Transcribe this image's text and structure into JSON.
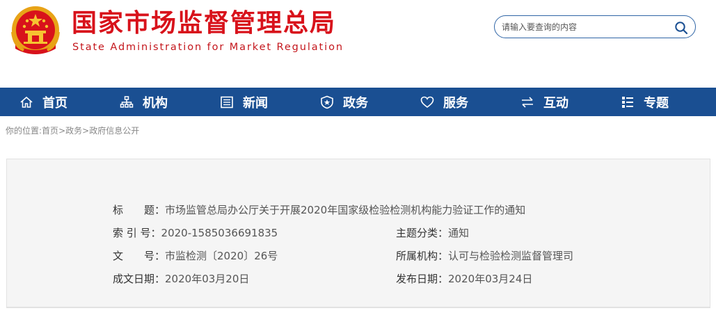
{
  "header": {
    "title_cn": "国家市场监督管理总局",
    "title_en": "State Administration for Market Regulation",
    "emblem_icon": "national-emblem-icon"
  },
  "search": {
    "placeholder": "请输入要查询的内容",
    "icon": "search-icon"
  },
  "nav": {
    "items": [
      {
        "label": "首页",
        "icon": "home-icon"
      },
      {
        "label": "机构",
        "icon": "organization-icon"
      },
      {
        "label": "新闻",
        "icon": "news-icon"
      },
      {
        "label": "政务",
        "icon": "government-icon"
      },
      {
        "label": "服务",
        "icon": "heart-icon"
      },
      {
        "label": "互动",
        "icon": "exchange-icon"
      },
      {
        "label": "专题",
        "icon": "topic-icon"
      }
    ]
  },
  "breadcrumb": {
    "prefix": "你的位置:",
    "items": [
      "首页",
      "政务",
      "政府信息公开"
    ],
    "separator": ">"
  },
  "info": {
    "title_label": "标　　题：",
    "title_value": "市场监管总局办公厅关于开展2020年国家级检验检测机构能力验证工作的通知",
    "index_label": "索 引 号：",
    "index_value": "2020-1585036691835",
    "category_label": "主题分类：",
    "category_value": "通知",
    "doc_label": "文　　号：",
    "doc_value": "市监检测〔2020〕26号",
    "org_label": "所属机构：",
    "org_value": "认可与检验检测监督管理司",
    "created_label": "成文日期：",
    "created_value": "2020年03月20日",
    "published_label": "发布日期：",
    "published_value": "2020年03月24日"
  },
  "colors": {
    "brand_red": "#d8121b",
    "nav_blue": "#1a4f92"
  }
}
